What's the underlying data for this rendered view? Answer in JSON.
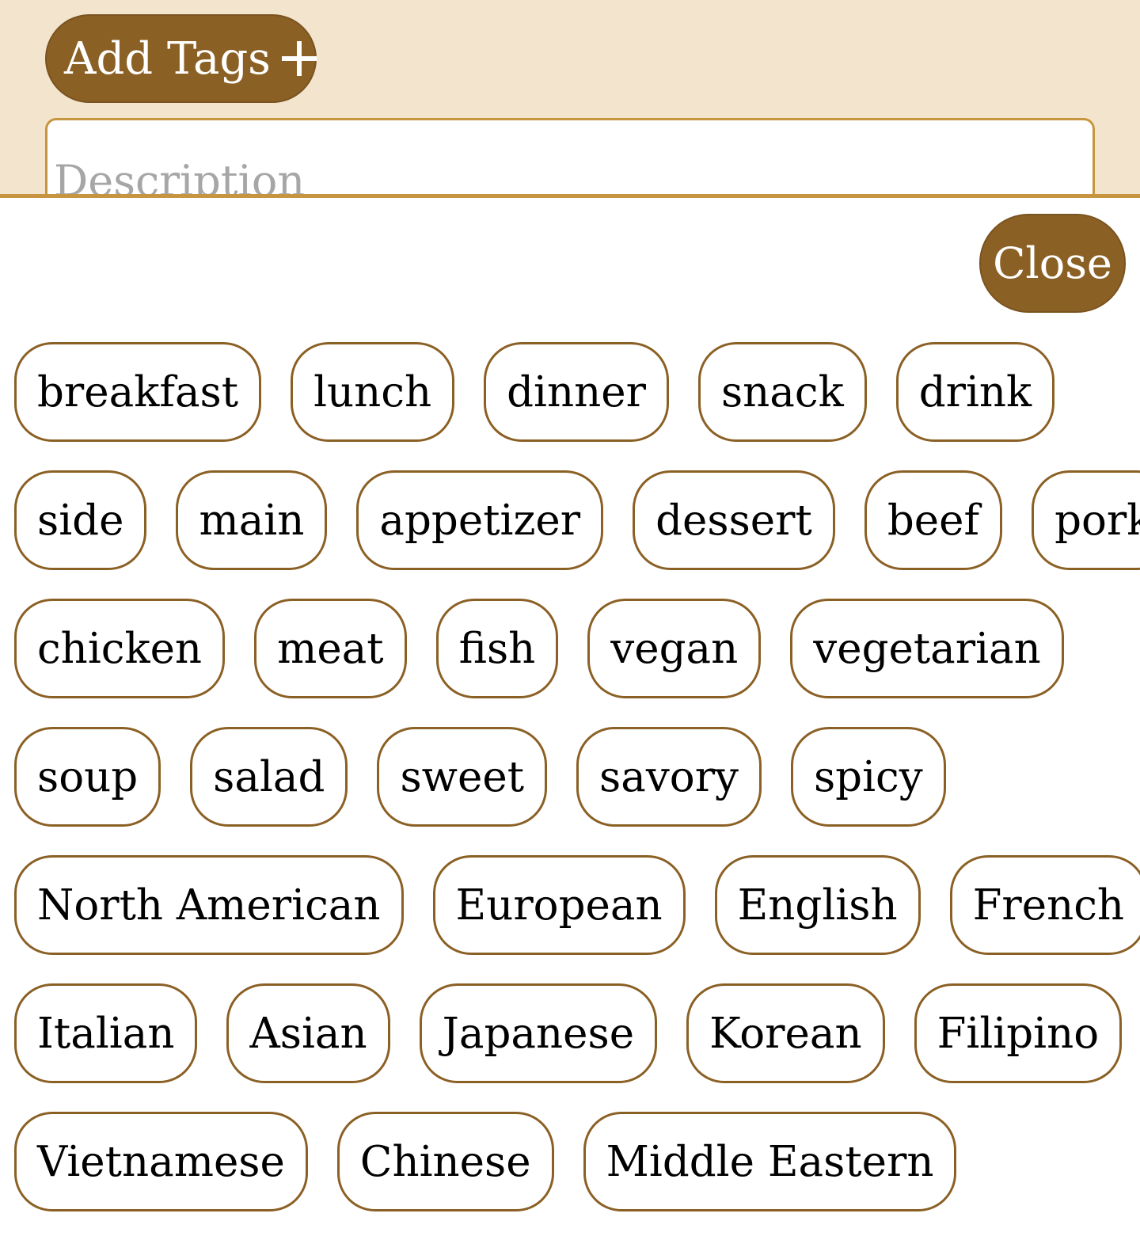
{
  "header": {
    "add_tags_label": "Add Tags",
    "add_icon": "plus-icon",
    "description_placeholder": "Description"
  },
  "close_label": "Close",
  "tag_rows": [
    [
      "breakfast",
      "lunch",
      "dinner",
      "snack",
      "drink"
    ],
    [
      "side",
      "main",
      "appetizer",
      "dessert",
      "beef",
      "pork"
    ],
    [
      "chicken",
      "meat",
      "fish",
      "vegan",
      "vegetarian"
    ],
    [
      "soup",
      "salad",
      "sweet",
      "savory",
      "spicy"
    ],
    [
      "North American",
      "European",
      "English",
      "French"
    ],
    [
      "Italian",
      "Asian",
      "Japanese",
      "Korean",
      "Filipino"
    ],
    [
      "Vietnamese",
      "Chinese",
      "Middle Eastern"
    ]
  ],
  "colors": {
    "header_bg": "#f3e4ce",
    "accent_brown": "#8b6025",
    "accent_gold": "#c7953f"
  }
}
